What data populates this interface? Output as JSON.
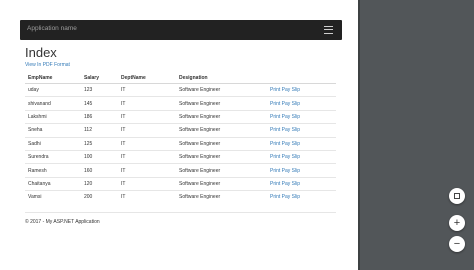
{
  "navbar": {
    "brand": "Application name"
  },
  "page": {
    "title": "Index",
    "pdf_link": "View In PDF Format"
  },
  "table": {
    "headers": [
      "EmpName",
      "Salary",
      "DeptName",
      "Designation",
      ""
    ],
    "rows": [
      [
        "uday",
        "123",
        "IT",
        "Software Engineer",
        "Print Pay Slip"
      ],
      [
        "shivanand",
        "145",
        "IT",
        "Software Engineer",
        "Print Pay Slip"
      ],
      [
        "Lakshmi",
        "186",
        "IT",
        "Software Engineer",
        "Print Pay Slip"
      ],
      [
        "Sneha",
        "112",
        "IT",
        "Software Engineer",
        "Print Pay Slip"
      ],
      [
        "Sadhi",
        "125",
        "IT",
        "Software Engineer",
        "Print Pay Slip"
      ],
      [
        "Surendra",
        "100",
        "IT",
        "Software Engineer",
        "Print Pay Slip"
      ],
      [
        "Ramesh",
        "160",
        "IT",
        "Software Engineer",
        "Print Pay Slip"
      ],
      [
        "Chaitanya",
        "120",
        "IT",
        "Software Engineer",
        "Print Pay Slip"
      ],
      [
        "Vamsi",
        "200",
        "IT",
        "Software Engineer",
        "Print Pay Slip"
      ]
    ]
  },
  "footer": {
    "text": "© 2017 - My ASP.NET Application"
  },
  "viewer_controls": {
    "fit_icon": "fit-to-page-icon",
    "zoom_in_label": "+",
    "zoom_out_label": "−"
  }
}
